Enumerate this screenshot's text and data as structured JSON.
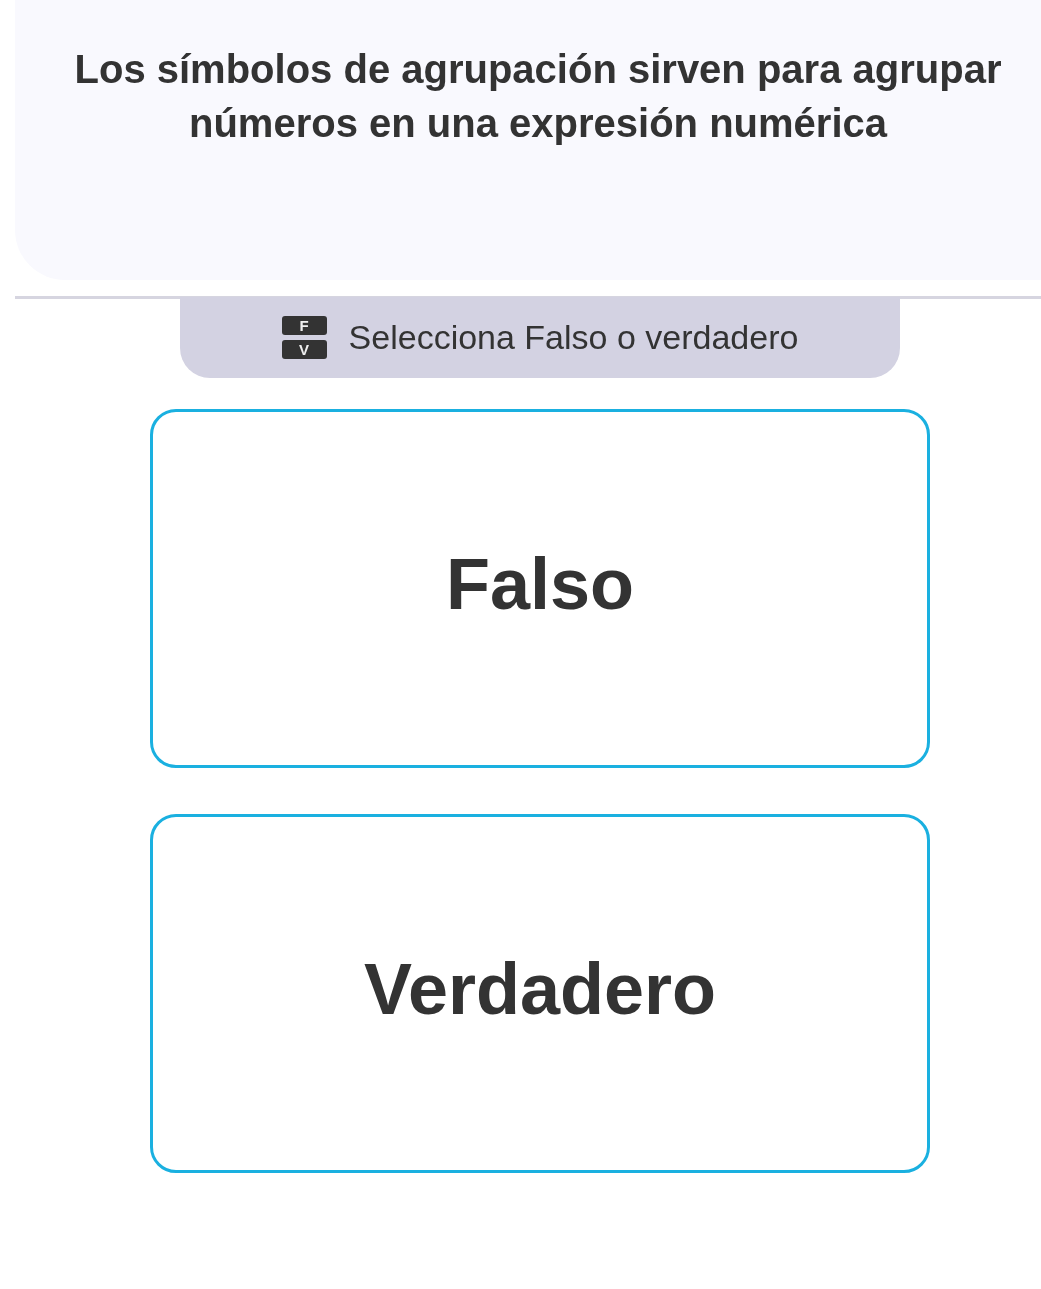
{
  "question": {
    "text": "Los símbolos de agrupación sirven para agrupar números en una expresión numérica"
  },
  "instruction": {
    "icon_letters": [
      "F",
      "V"
    ],
    "text": "Selecciona Falso o verdadero"
  },
  "options": [
    {
      "label": "Falso",
      "selected": false
    },
    {
      "label": "Verdadero",
      "selected": false
    }
  ]
}
